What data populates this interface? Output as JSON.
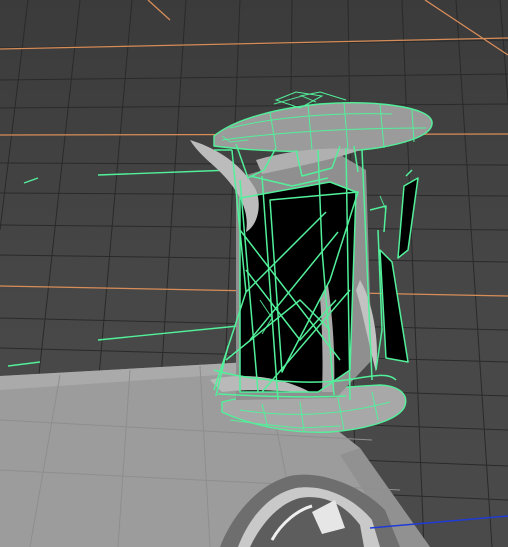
{
  "viewport": {
    "background_color": "#464646",
    "grid_line_color": "#2b2b2b",
    "grid_major_color": "#e0915b",
    "axis_z_color": "#1f3bd6",
    "wireframe_color": "#52f09a",
    "mesh_fill_color": "#000000",
    "ground_plane_color": "#9d9d9d"
  },
  "objects": [
    {
      "name": "broken-pedestal-mesh",
      "state": "selected",
      "display": "wireframe-on-shaded"
    },
    {
      "name": "ground-plane",
      "state": "unselected",
      "display": "shaded"
    },
    {
      "name": "reflection-object",
      "state": "unselected",
      "display": "shaded"
    }
  ]
}
